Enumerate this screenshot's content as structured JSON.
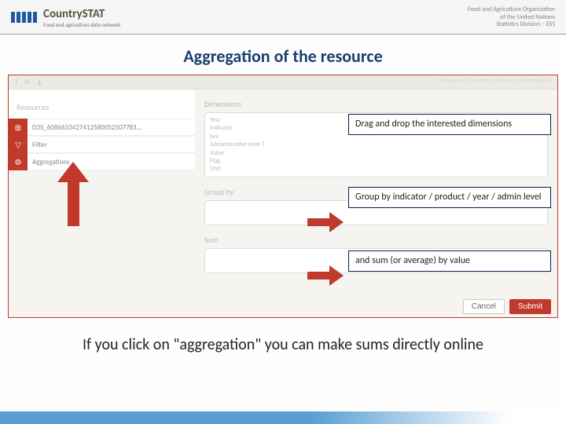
{
  "header": {
    "brand": "CountrySTAT",
    "brand_sub": "Food and agriculture data network",
    "right_line1": "Food and Agriculture Organization",
    "right_line2": "of the United Nations",
    "right_line3": "Statistics Division – ESS"
  },
  "title": "Aggregation of the resource",
  "topbar_reversed": "Population by sex (sub-national) (computed)",
  "resources": {
    "title": "Resources",
    "items": [
      {
        "icon": "⊞",
        "label": "D3S_608663342741258005250778З..."
      },
      {
        "icon": "▽",
        "label": "Filter"
      },
      {
        "icon": "⚙",
        "label": "Aggregations"
      }
    ]
  },
  "dimensions": {
    "label": "Dimensions",
    "items": [
      "Year",
      "Indicator",
      "Sex",
      "Administrative level 1",
      "Value",
      "Flag",
      "Unit"
    ]
  },
  "groupby_label": "Group by",
  "sum_label": "Sum",
  "annotations": {
    "a1": "Drag and drop the interested dimensions",
    "a2": "Group by indicator / product / year / admin level",
    "a3": "and sum (or average)  by value"
  },
  "buttons": {
    "cancel": "Cancel",
    "submit": "Submit"
  },
  "caption": "If you click on \"aggregation\" you can make sums directly online"
}
